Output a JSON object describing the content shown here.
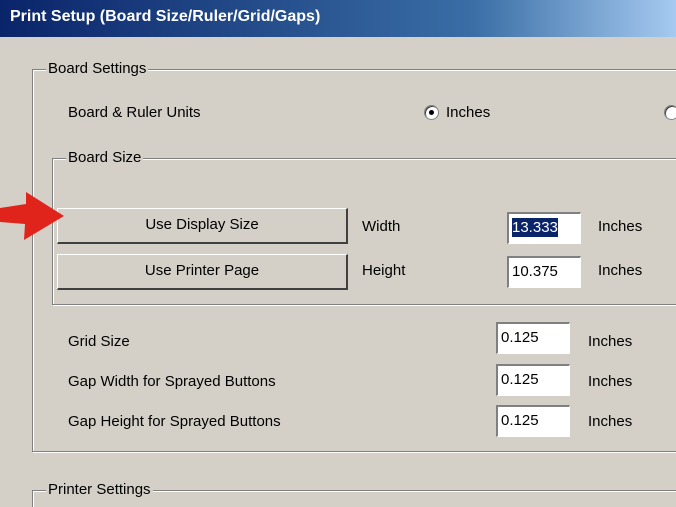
{
  "window": {
    "title": "Print Setup (Board Size/Ruler/Grid/Gaps)"
  },
  "board_settings": {
    "legend": "Board Settings",
    "units_label": "Board & Ruler Units",
    "units_option_inches": "Inches",
    "units_selected": "Inches"
  },
  "board_size": {
    "legend": "Board Size",
    "use_display_size_label": "Use Display Size",
    "use_printer_page_label": "Use Printer Page",
    "width_label": "Width",
    "width_value": "13.333",
    "width_unit": "Inches",
    "height_label": "Height",
    "height_value": "10.375",
    "height_unit": "Inches"
  },
  "grid": {
    "grid_size_label": "Grid Size",
    "grid_size_value": "0.125",
    "grid_size_unit": "Inches",
    "gap_width_label": "Gap Width for Sprayed Buttons",
    "gap_width_value": "0.125",
    "gap_width_unit": "Inches",
    "gap_height_label": "Gap Height for Sprayed Buttons",
    "gap_height_value": "0.125",
    "gap_height_unit": "Inches"
  },
  "printer_settings": {
    "legend": "Printer Settings"
  },
  "colors": {
    "title_bar": "#0a246a",
    "dialog_bg": "#d4d0c8",
    "arrow": "#e0241b"
  },
  "icons": {
    "pointer": "red-arrow-icon"
  }
}
